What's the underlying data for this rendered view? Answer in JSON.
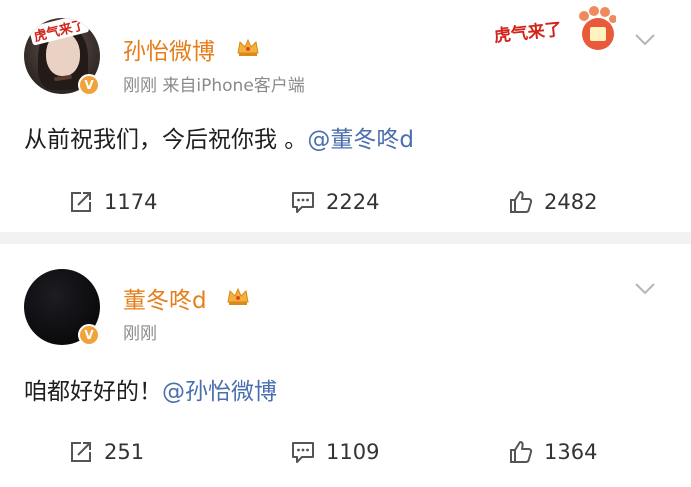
{
  "posts": [
    {
      "username": "孙怡微博",
      "meta": "刚刚  来自iPhone客户端",
      "content_text": "从前祝我们，今后祝你我 。",
      "mention": "@董冬咚d",
      "repost_count": "1174",
      "comment_count": "2224",
      "like_count": "2482",
      "avatar_banner": "虎气来了",
      "header_badge": "虎气来了"
    },
    {
      "username": "董冬咚d",
      "meta": "刚刚",
      "content_text": "咱都好好的！",
      "mention": "@孙怡微博",
      "repost_count": "251",
      "comment_count": "1109",
      "like_count": "1364"
    }
  ],
  "icons": {
    "repost": "repost-icon",
    "comment": "comment-icon",
    "like": "like-icon",
    "more": "chevron-down-icon",
    "verified": "verified-v-icon",
    "vip": "crown-icon"
  },
  "colors": {
    "username": "#e67e19",
    "mention": "#4b6fae",
    "meta": "#8a8a8a",
    "verified": "#f0a33a",
    "tiger_red": "#d3241b",
    "divider": "#f2f2f2"
  }
}
